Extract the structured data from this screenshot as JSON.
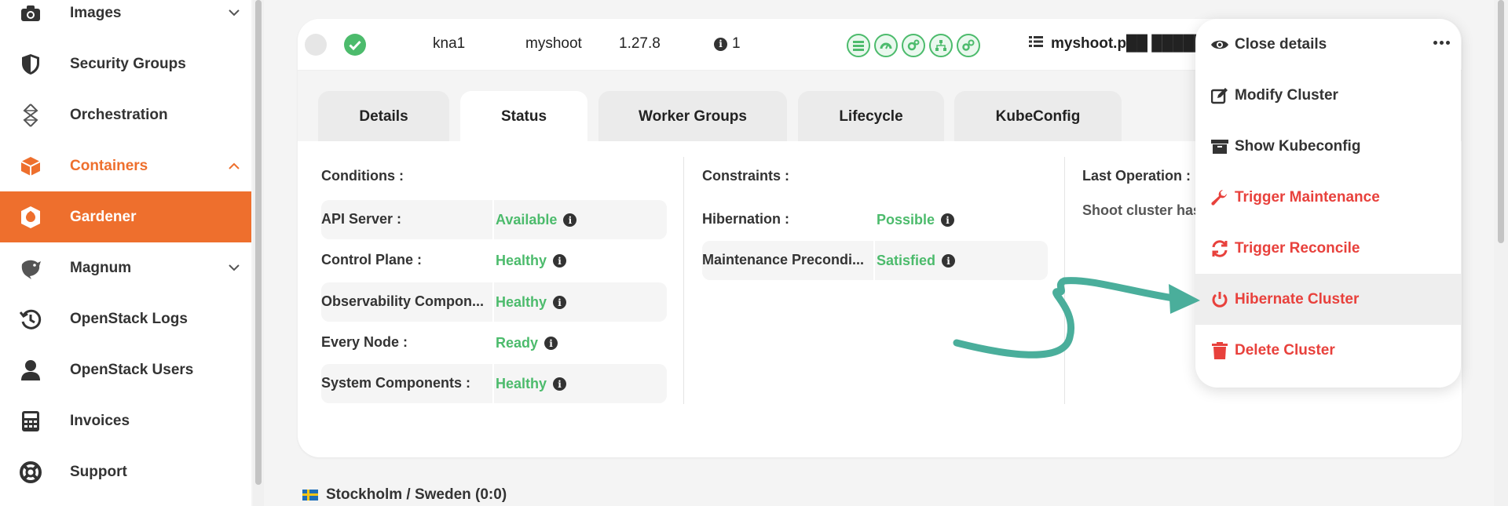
{
  "sidebar": {
    "items": [
      {
        "label": "Images",
        "icon": "camera-icon"
      },
      {
        "label": "Security Groups",
        "icon": "shield-icon"
      },
      {
        "label": "Orchestration",
        "icon": "orchestration-icon"
      },
      {
        "label": "Containers",
        "icon": "container-box-icon"
      },
      {
        "label": "Gardener",
        "icon": "gardener-icon"
      },
      {
        "label": "Magnum",
        "icon": "magnum-shark-icon"
      },
      {
        "label": "OpenStack Logs",
        "icon": "history-icon"
      },
      {
        "label": "OpenStack Users",
        "icon": "user-icon"
      },
      {
        "label": "Invoices",
        "icon": "calculator-icon"
      },
      {
        "label": "Support",
        "icon": "lifebuoy-icon"
      }
    ]
  },
  "cluster": {
    "region": "kna1",
    "name": "myshoot",
    "version": "1.27.8",
    "info_count": "1",
    "domain": "myshoot.p██ ██████"
  },
  "tabs": [
    "Details",
    "Status",
    "Worker Groups",
    "Lifecycle",
    "KubeConfig"
  ],
  "status": {
    "conditions_title": "Conditions :",
    "conditions": [
      {
        "label": "API Server :",
        "value": "Available"
      },
      {
        "label": "Control Plane :",
        "value": "Healthy"
      },
      {
        "label": "Observability Compon...",
        "value": "Healthy"
      },
      {
        "label": "Every Node :",
        "value": "Ready"
      },
      {
        "label": "System Components :",
        "value": "Healthy"
      }
    ],
    "constraints_title": "Constraints :",
    "constraints": [
      {
        "label": "Hibernation :",
        "value": "Possible"
      },
      {
        "label": "Maintenance Precondi...",
        "value": "Satisfied"
      }
    ],
    "last_operation_title": "Last Operation :",
    "last_operation_text": "Shoot cluster has"
  },
  "footer": {
    "location": "Stockholm / Sweden (0:0)"
  },
  "menu": {
    "items": [
      {
        "label": "Close details",
        "icon": "eye-icon"
      },
      {
        "label": "Modify Cluster",
        "icon": "edit-icon"
      },
      {
        "label": "Show Kubeconfig",
        "icon": "archive-icon"
      },
      {
        "label": "Trigger Maintenance",
        "icon": "wrench-icon"
      },
      {
        "label": "Trigger Reconcile",
        "icon": "sync-icon"
      },
      {
        "label": "Hibernate Cluster",
        "icon": "power-icon"
      },
      {
        "label": "Delete Cluster",
        "icon": "trash-icon"
      }
    ]
  },
  "colors": {
    "accent": "#ee6f2d",
    "success": "#4cbb6c",
    "danger": "#e8413c",
    "annotation_arrow": "#4aae9b"
  }
}
